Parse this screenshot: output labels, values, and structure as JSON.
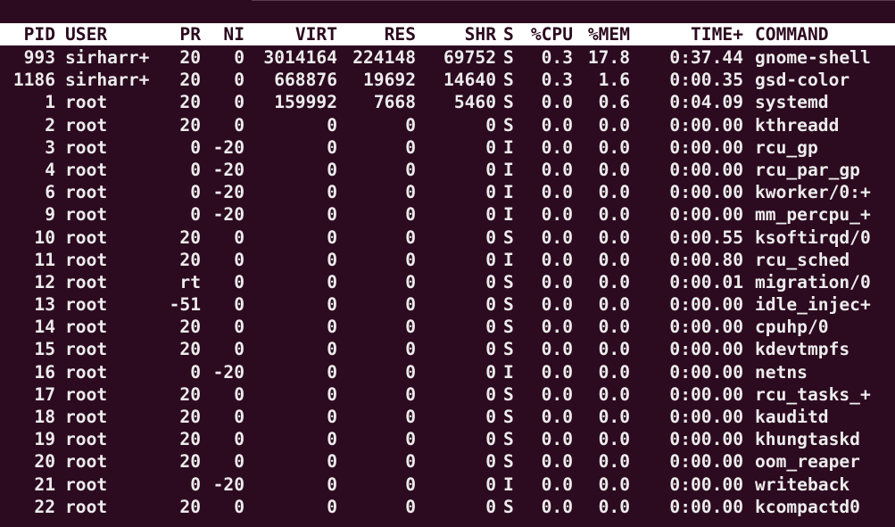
{
  "colors": {
    "background": "#2c0a1f",
    "text": "#ececec",
    "header_bg": "#ffffff",
    "header_text": "#2c0a1f"
  },
  "header": {
    "pid": "PID",
    "user": "USER",
    "pr": "PR",
    "ni": "NI",
    "virt": "VIRT",
    "res": "RES",
    "shr": "SHR",
    "s": "S",
    "cpu": "%CPU",
    "mem": "%MEM",
    "time": "TIME+",
    "command": "COMMAND"
  },
  "processes": [
    {
      "pid": "993",
      "user": "sirharr+",
      "pr": "20",
      "ni": "0",
      "virt": "3014164",
      "res": "224148",
      "shr": "69752",
      "s": "S",
      "cpu": "0.3",
      "mem": "17.8",
      "time": "0:37.44",
      "command": "gnome-shell"
    },
    {
      "pid": "1186",
      "user": "sirharr+",
      "pr": "20",
      "ni": "0",
      "virt": "668876",
      "res": "19692",
      "shr": "14640",
      "s": "S",
      "cpu": "0.3",
      "mem": "1.6",
      "time": "0:00.35",
      "command": "gsd-color"
    },
    {
      "pid": "1",
      "user": "root",
      "pr": "20",
      "ni": "0",
      "virt": "159992",
      "res": "7668",
      "shr": "5460",
      "s": "S",
      "cpu": "0.0",
      "mem": "0.6",
      "time": "0:04.09",
      "command": "systemd"
    },
    {
      "pid": "2",
      "user": "root",
      "pr": "20",
      "ni": "0",
      "virt": "0",
      "res": "0",
      "shr": "0",
      "s": "S",
      "cpu": "0.0",
      "mem": "0.0",
      "time": "0:00.00",
      "command": "kthreadd"
    },
    {
      "pid": "3",
      "user": "root",
      "pr": "0",
      "ni": "-20",
      "virt": "0",
      "res": "0",
      "shr": "0",
      "s": "I",
      "cpu": "0.0",
      "mem": "0.0",
      "time": "0:00.00",
      "command": "rcu_gp"
    },
    {
      "pid": "4",
      "user": "root",
      "pr": "0",
      "ni": "-20",
      "virt": "0",
      "res": "0",
      "shr": "0",
      "s": "I",
      "cpu": "0.0",
      "mem": "0.0",
      "time": "0:00.00",
      "command": "rcu_par_gp"
    },
    {
      "pid": "6",
      "user": "root",
      "pr": "0",
      "ni": "-20",
      "virt": "0",
      "res": "0",
      "shr": "0",
      "s": "I",
      "cpu": "0.0",
      "mem": "0.0",
      "time": "0:00.00",
      "command": "kworker/0:+"
    },
    {
      "pid": "9",
      "user": "root",
      "pr": "0",
      "ni": "-20",
      "virt": "0",
      "res": "0",
      "shr": "0",
      "s": "I",
      "cpu": "0.0",
      "mem": "0.0",
      "time": "0:00.00",
      "command": "mm_percpu_+"
    },
    {
      "pid": "10",
      "user": "root",
      "pr": "20",
      "ni": "0",
      "virt": "0",
      "res": "0",
      "shr": "0",
      "s": "S",
      "cpu": "0.0",
      "mem": "0.0",
      "time": "0:00.55",
      "command": "ksoftirqd/0"
    },
    {
      "pid": "11",
      "user": "root",
      "pr": "20",
      "ni": "0",
      "virt": "0",
      "res": "0",
      "shr": "0",
      "s": "I",
      "cpu": "0.0",
      "mem": "0.0",
      "time": "0:00.80",
      "command": "rcu_sched"
    },
    {
      "pid": "12",
      "user": "root",
      "pr": "rt",
      "ni": "0",
      "virt": "0",
      "res": "0",
      "shr": "0",
      "s": "S",
      "cpu": "0.0",
      "mem": "0.0",
      "time": "0:00.01",
      "command": "migration/0"
    },
    {
      "pid": "13",
      "user": "root",
      "pr": "-51",
      "ni": "0",
      "virt": "0",
      "res": "0",
      "shr": "0",
      "s": "S",
      "cpu": "0.0",
      "mem": "0.0",
      "time": "0:00.00",
      "command": "idle_injec+"
    },
    {
      "pid": "14",
      "user": "root",
      "pr": "20",
      "ni": "0",
      "virt": "0",
      "res": "0",
      "shr": "0",
      "s": "S",
      "cpu": "0.0",
      "mem": "0.0",
      "time": "0:00.00",
      "command": "cpuhp/0"
    },
    {
      "pid": "15",
      "user": "root",
      "pr": "20",
      "ni": "0",
      "virt": "0",
      "res": "0",
      "shr": "0",
      "s": "S",
      "cpu": "0.0",
      "mem": "0.0",
      "time": "0:00.00",
      "command": "kdevtmpfs"
    },
    {
      "pid": "16",
      "user": "root",
      "pr": "0",
      "ni": "-20",
      "virt": "0",
      "res": "0",
      "shr": "0",
      "s": "I",
      "cpu": "0.0",
      "mem": "0.0",
      "time": "0:00.00",
      "command": "netns"
    },
    {
      "pid": "17",
      "user": "root",
      "pr": "20",
      "ni": "0",
      "virt": "0",
      "res": "0",
      "shr": "0",
      "s": "S",
      "cpu": "0.0",
      "mem": "0.0",
      "time": "0:00.00",
      "command": "rcu_tasks_+"
    },
    {
      "pid": "18",
      "user": "root",
      "pr": "20",
      "ni": "0",
      "virt": "0",
      "res": "0",
      "shr": "0",
      "s": "S",
      "cpu": "0.0",
      "mem": "0.0",
      "time": "0:00.00",
      "command": "kauditd"
    },
    {
      "pid": "19",
      "user": "root",
      "pr": "20",
      "ni": "0",
      "virt": "0",
      "res": "0",
      "shr": "0",
      "s": "S",
      "cpu": "0.0",
      "mem": "0.0",
      "time": "0:00.00",
      "command": "khungtaskd"
    },
    {
      "pid": "20",
      "user": "root",
      "pr": "20",
      "ni": "0",
      "virt": "0",
      "res": "0",
      "shr": "0",
      "s": "S",
      "cpu": "0.0",
      "mem": "0.0",
      "time": "0:00.00",
      "command": "oom_reaper"
    },
    {
      "pid": "21",
      "user": "root",
      "pr": "0",
      "ni": "-20",
      "virt": "0",
      "res": "0",
      "shr": "0",
      "s": "I",
      "cpu": "0.0",
      "mem": "0.0",
      "time": "0:00.00",
      "command": "writeback"
    },
    {
      "pid": "22",
      "user": "root",
      "pr": "20",
      "ni": "0",
      "virt": "0",
      "res": "0",
      "shr": "0",
      "s": "S",
      "cpu": "0.0",
      "mem": "0.0",
      "time": "0:00.00",
      "command": "kcompactd0"
    }
  ]
}
